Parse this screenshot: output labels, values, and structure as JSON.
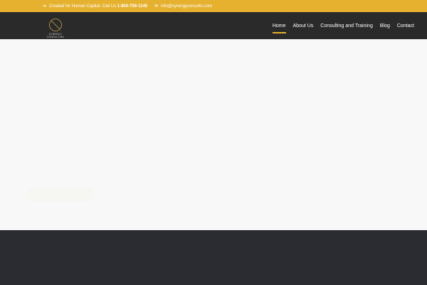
{
  "topbar": {
    "tagline": "Created for Human Capital. Call Us",
    "phone": "1-800-706-1140",
    "email": "info@synergyconsults.com"
  },
  "logo": {
    "text": "SYNERGY CONSULTING"
  },
  "nav": {
    "items": [
      {
        "label": "Home",
        "active": true
      },
      {
        "label": "About Us"
      },
      {
        "label": "Consulting and Training"
      },
      {
        "label": "Blog"
      },
      {
        "label": "Contact"
      }
    ]
  },
  "colors": {
    "accent": "#e5b12f",
    "dark": "#2a2a2a",
    "hero": "#f8f8f8"
  }
}
